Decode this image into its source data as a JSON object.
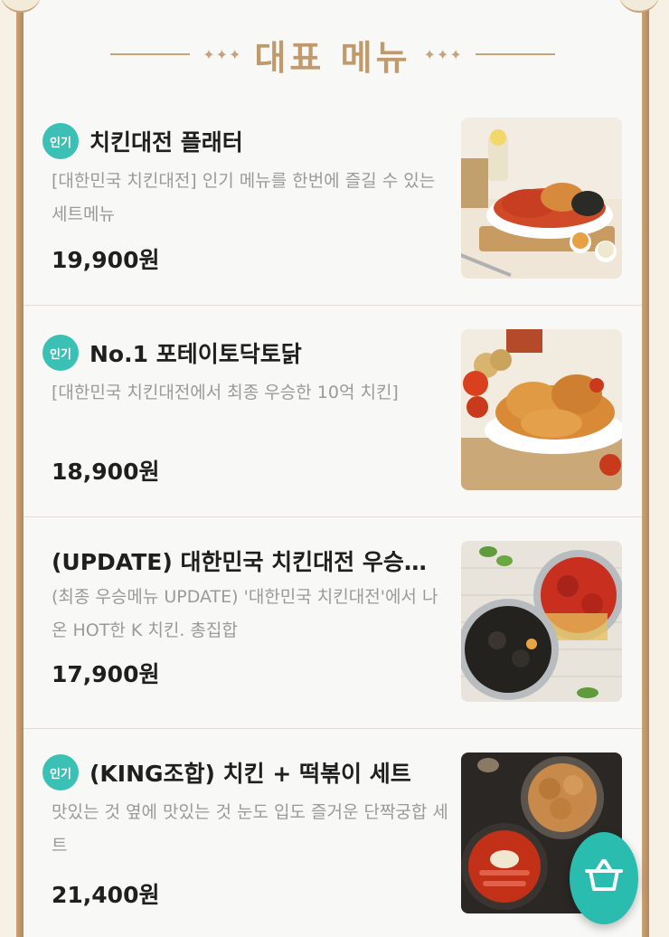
{
  "section": {
    "title": "대표 메뉴",
    "left_ornament": "✦✦✦",
    "right_ornament": "✦✦✦"
  },
  "items": [
    {
      "badge": "인기",
      "title": "치킨대전 플래터",
      "desc": "[대한민국 치킨대전] 인기 메뉴를 한번에 즐길 수 있는 세트메뉴",
      "price": "19,900원"
    },
    {
      "badge": "인기",
      "title": "No.1 포테이토닥토닭",
      "desc": "[대한민국 치킨대전에서 최종 우승한 10억 치킨]",
      "price": "18,900원"
    },
    {
      "badge": "",
      "title": "(UPDATE) 대한민국 치킨대전 우승…",
      "desc": "(최종 우승메뉴 UPDATE) '대한민국 치킨대전'에서 나온 HOT한 K 치킨. 총집합",
      "price": "17,900원"
    },
    {
      "badge": "인기",
      "title": "(KING조합) 치킨 + 떡볶이 세트",
      "desc": "맛있는 것 옆에 맛있는 것 눈도 입도 즐거운 단짝궁합 세트",
      "price": "21,400원"
    }
  ],
  "cart": {
    "icon": "shopping-basket-icon"
  }
}
